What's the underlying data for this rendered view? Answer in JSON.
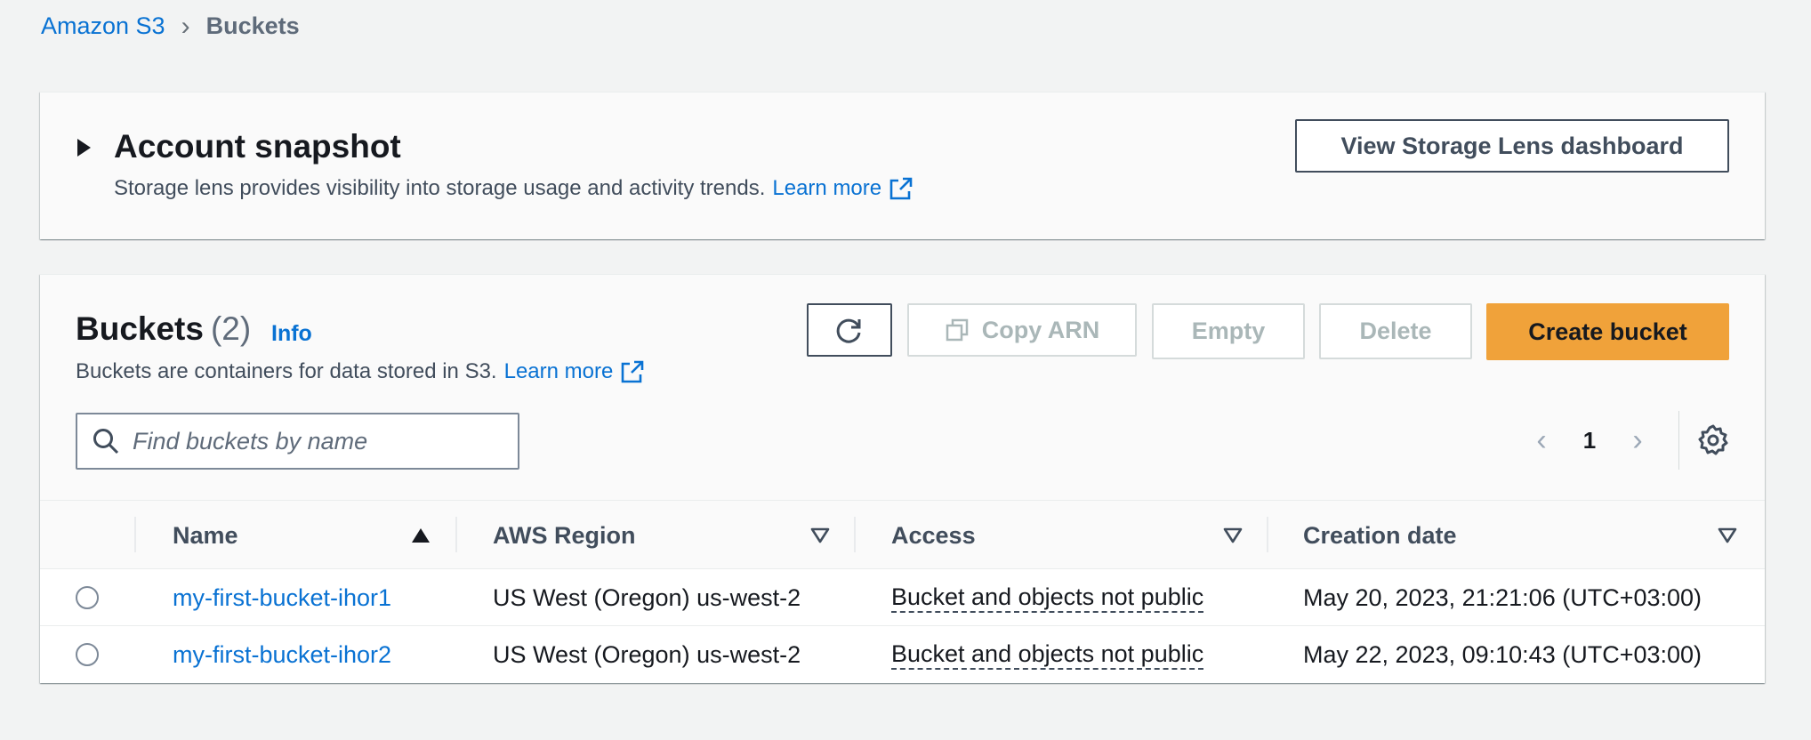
{
  "breadcrumb": {
    "root": "Amazon S3",
    "current": "Buckets"
  },
  "snapshot": {
    "title": "Account snapshot",
    "description": "Storage lens provides visibility into storage usage and activity trends.",
    "learn_more": "Learn more",
    "lens_button": "View Storage Lens dashboard"
  },
  "buckets": {
    "title": "Buckets",
    "count": "(2)",
    "info": "Info",
    "description": "Buckets are containers for data stored in S3.",
    "learn_more": "Learn more",
    "actions": {
      "copy_arn": "Copy ARN",
      "empty": "Empty",
      "delete": "Delete",
      "create": "Create bucket"
    },
    "search": {
      "placeholder": "Find buckets by name",
      "value": ""
    },
    "pagination": {
      "current_page": "1"
    },
    "columns": [
      "Name",
      "AWS Region",
      "Access",
      "Creation date"
    ],
    "rows": [
      {
        "name": "my-first-bucket-ihor1",
        "region": "US West (Oregon) us-west-2",
        "access": "Bucket and objects not public",
        "created": "May 20, 2023, 21:21:06 (UTC+03:00)"
      },
      {
        "name": "my-first-bucket-ihor2",
        "region": "US West (Oregon) us-west-2",
        "access": "Bucket and objects not public",
        "created": "May 22, 2023, 09:10:43 (UTC+03:00)"
      }
    ]
  },
  "colors": {
    "link": "#0972d3",
    "primary_button": "#f0a23a",
    "background": "#f2f3f3"
  }
}
